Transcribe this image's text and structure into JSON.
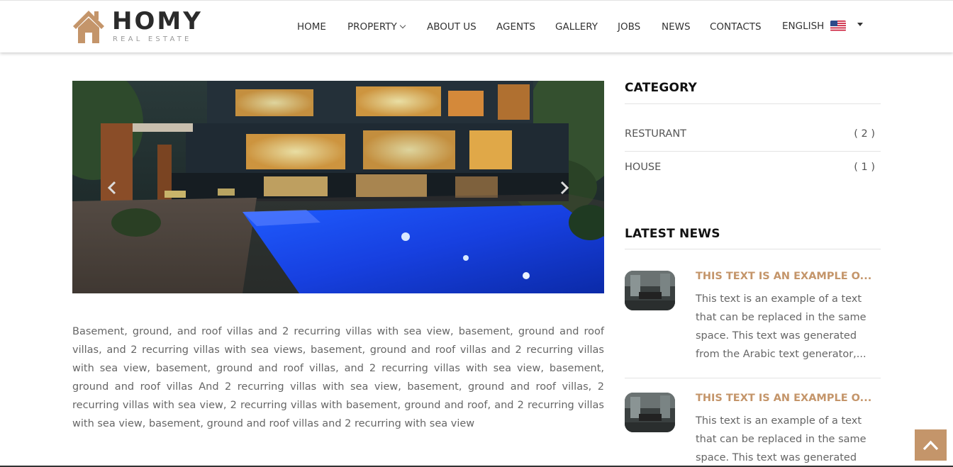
{
  "logo": {
    "title": "HOMY",
    "subtitle": "REAL ESTATE"
  },
  "nav": {
    "items": [
      {
        "label": "HOME"
      },
      {
        "label": "PROPERTY"
      },
      {
        "label": "ABOUT US"
      },
      {
        "label": "AGENTS"
      },
      {
        "label": "GALLERY"
      },
      {
        "label": "JOBS"
      },
      {
        "label": "NEWS"
      },
      {
        "label": "CONTACTS"
      }
    ],
    "language": "ENGLISH"
  },
  "slider": {
    "prev_icon": "chevron-left-icon",
    "next_icon": "chevron-right-icon"
  },
  "description": "Basement, ground, and roof villas and 2 recurring villas with sea view, basement, ground and roof villas, and 2 recurring villas with sea views, basement, ground and roof villas and 2 recurring villas with sea view, basement, ground and roof villas, and 2 recurring villas with sea view, basement, ground and roof villas And 2 recurring villas with sea view, basement, ground and roof villas, 2 recurring villas with sea view, 2 recurring villas with basement, ground and roof, and 2 recurring villas with sea view, basement, ground and roof villas and 2 recurring with sea view",
  "sidebar": {
    "category_title": "CATEGORY",
    "categories": [
      {
        "name": "RESTURANT",
        "count": "( 2 )"
      },
      {
        "name": "HOUSE",
        "count": "( 1 )"
      }
    ],
    "news_title": "LATEST NEWS",
    "news": [
      {
        "title": "THIS TEXT IS AN EXAMPLE O...",
        "text": "This text is an example of a text that can be replaced in the same space. This text was generated from the Arabic text generator,..."
      },
      {
        "title": "THIS TEXT IS AN EXAMPLE O...",
        "text": "This text is an example of a text that can be replaced in the same space. This text was generated from the Arabic text generator,..."
      }
    ]
  },
  "colors": {
    "accent": "#c4956a",
    "text": "#555555",
    "heading": "#111111"
  }
}
